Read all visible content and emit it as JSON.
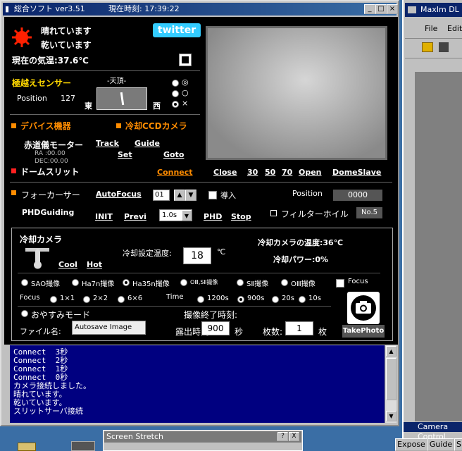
{
  "window": {
    "title": "総合ソフト ver3.51",
    "time_label": "現在時刻: 17:39:22"
  },
  "weather": {
    "line1": "晴れています",
    "line2": "乾いています",
    "twitter": "twitter",
    "temp_label": "現在の気温:37.6℃"
  },
  "horizon": {
    "title": "極越えセンサー",
    "zenith": "-天頂-",
    "position_label": "Position",
    "position_value": "127",
    "east": "東",
    "west": "西",
    "options": [
      "◎",
      "○",
      "×"
    ]
  },
  "devices": {
    "label": "デバイス機器",
    "ccd_label": "冷却CCDカメラ"
  },
  "mount": {
    "label": "赤道儀モーター",
    "track": "Track",
    "guide": "Guide",
    "set": "Set",
    "goto": "Goto",
    "ra": "RA :00.00",
    "dec": "DEC:00.00"
  },
  "dome": {
    "label": "ドームスリット",
    "connect": "Connect",
    "close": "Close",
    "p30": "30",
    "p50": "50",
    "p70": "70",
    "open": "Open",
    "slave": "DomeSlave"
  },
  "focuser": {
    "label": "フォーカーサー",
    "autofocus": "AutoFocus",
    "value": "01",
    "intro": "導入",
    "position_label": "Position",
    "position_value": "0000"
  },
  "phd": {
    "label": "PHDGuiding",
    "init": "INIT",
    "previ": "Previ",
    "exposure": "1.0s",
    "phd": "PHD",
    "stop": "Stop",
    "filter_label": "フィルターホイル",
    "filter_value": "No.5"
  },
  "camera": {
    "title": "冷却カメラ",
    "cool": "Cool",
    "hot": "Hot",
    "set_temp_label": "冷却設定温度:",
    "set_temp_value": "18",
    "set_temp_unit": "℃",
    "temp_status": "冷却カメラの温度:36℃",
    "power_status": "冷却パワー:0%",
    "modes": [
      "SAO撮像",
      "Ha7n撮像",
      "Ha35n撮像",
      "OⅢ,SⅡ撮像",
      "SⅡ撮像",
      "OⅢ撮像"
    ],
    "focus_check": "Focus",
    "focus_label": "Focus",
    "focus_opts": [
      "1×1",
      "2×2",
      "6×6"
    ],
    "time_label": "Time",
    "time_opts": [
      "1200s",
      "900s",
      "20s",
      "10s"
    ],
    "sleep": "おやすみモード",
    "end_time_label": "撮像終了時刻:",
    "filename_label": "ファイル名:",
    "filename_value": "Autosave Image",
    "exposure_label": "露出時間:",
    "exposure_value": "900",
    "exposure_unit": "秒",
    "count_label": "枚数:",
    "count_value": "1",
    "count_unit": "枚",
    "take_photo": "TakePhoto"
  },
  "log": {
    "lines": "Connect  3秒\nConnect  2秒\nConnect  1秒\nConnect  0秒\nカメラ接続しました。\n晴れています。\n乾いています。\nスリットサーバ接続"
  },
  "right_window": {
    "title": "MaxIm DL",
    "menu_file": "File",
    "menu_edit": "Edit",
    "camera_control": "Camera Control",
    "tab_expose": "Expose",
    "tab_guide": "Guide",
    "tab_s": "S"
  },
  "bottom": {
    "stretch_title": "Screen Stretch",
    "help": "?",
    "close": "X"
  }
}
